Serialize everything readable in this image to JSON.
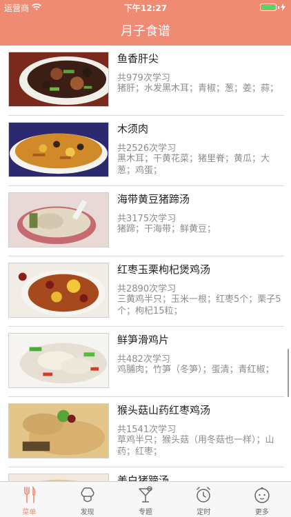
{
  "status": {
    "carrier": "运营商",
    "time": "下午12:27"
  },
  "nav": {
    "title": "月子食谱"
  },
  "recipes": [
    {
      "title": "鱼香肝尖",
      "count": "共979次学习",
      "ingredients": "猪肝；水发黑木耳；青椒；葱；姜；蒜；"
    },
    {
      "title": "木须肉",
      "count": "共2526次学习",
      "ingredients": "黑木耳；干黄花菜；猪里脊；黄瓜；大葱；鸡蛋；"
    },
    {
      "title": "海带黄豆猪蹄汤",
      "count": "共3175次学习",
      "ingredients": "猪蹄；干海带；鲜黄豆；"
    },
    {
      "title": "红枣玉栗枸杞煲鸡汤",
      "count": "共2890次学习",
      "ingredients": "三黄鸡半只；玉米一根；红枣5个；栗子5个；枸杞15粒；"
    },
    {
      "title": "鲜笋滑鸡片",
      "count": "共482次学习",
      "ingredients": "鸡脯肉；竹笋（冬笋）；蛋清；青红椒；"
    },
    {
      "title": "猴头菇山药红枣鸡汤",
      "count": "共1541次学习",
      "ingredients": "草鸡半只；猴头菇（用冬菇也一样）；山药；红枣；"
    },
    {
      "title": "美白猪蹄汤",
      "count": "",
      "ingredients": ""
    }
  ],
  "tabs": [
    {
      "label": "菜单",
      "icon": "fork-knife-icon"
    },
    {
      "label": "发现",
      "icon": "chef-hat-icon"
    },
    {
      "label": "专题",
      "icon": "cocktail-icon"
    },
    {
      "label": "定时",
      "icon": "alarm-clock-icon"
    },
    {
      "label": "更多",
      "icon": "baby-face-icon"
    }
  ],
  "colors": {
    "accent": "#ef8a73",
    "statusbar": "#ef8a73",
    "battery": "#4cd964",
    "text_secondary": "#8c8c8c"
  }
}
